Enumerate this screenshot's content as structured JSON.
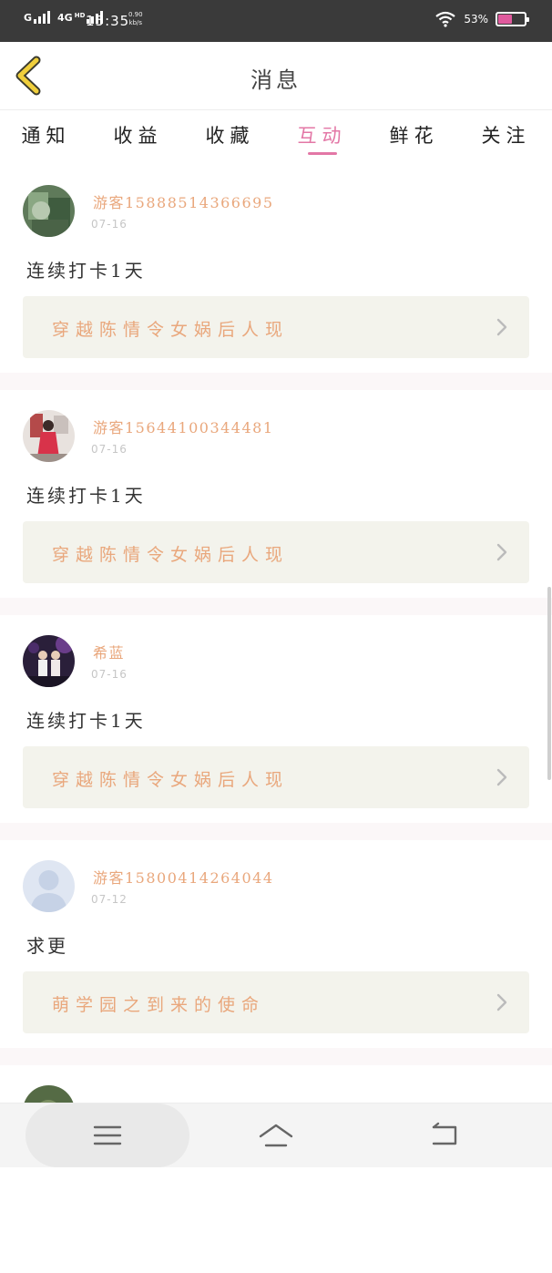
{
  "status_bar": {
    "network_g": "G",
    "network_4g": "4G",
    "network_hd": "HD",
    "time": "15:35",
    "speed_value": "0.90",
    "speed_unit": "kb/s",
    "battery_percent": "53%",
    "battery_level": 0.53,
    "battery_color": "#e05a9d"
  },
  "header": {
    "back_icon": "chevron-left-icon",
    "title": "消息"
  },
  "tabs": [
    {
      "label": "通知",
      "active": false
    },
    {
      "label": "收益",
      "active": false
    },
    {
      "label": "收藏",
      "active": false
    },
    {
      "label": "互动",
      "active": true
    },
    {
      "label": "鲜花",
      "active": false
    },
    {
      "label": "关注",
      "active": false
    }
  ],
  "theme": {
    "accent": "#e377a6",
    "username_color": "#e9a77c",
    "link_bg": "#f3f3ec"
  },
  "messages": [
    {
      "username": "游客15888514366695",
      "date": "07-16",
      "comment": "连续打卡1天",
      "book_title": "穿越陈情令女娲后人现"
    },
    {
      "username": "游客15644100344481",
      "date": "07-16",
      "comment": "连续打卡1天",
      "book_title": "穿越陈情令女娲后人现"
    },
    {
      "username": "希蓝",
      "date": "07-16",
      "comment": "连续打卡1天",
      "book_title": "穿越陈情令女娲后人现"
    },
    {
      "username": "游客15800414264044",
      "date": "07-12",
      "comment": "求更",
      "book_title": "萌学园之到来的使命"
    }
  ],
  "nav_bar": {
    "menu_icon": "menu-icon",
    "home_icon": "home-icon",
    "back_icon": "back-icon"
  }
}
